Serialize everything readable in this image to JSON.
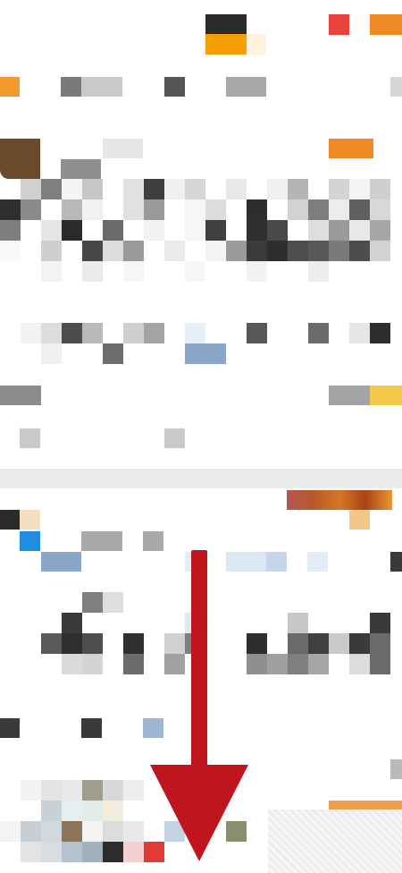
{
  "screen": {
    "description_visible_text": [],
    "colors": {
      "accent_orange": "#f5a000",
      "accent_red": "#e8433a",
      "annotation_arrow": "#c0141f",
      "divider": "#ebebeb"
    }
  }
}
